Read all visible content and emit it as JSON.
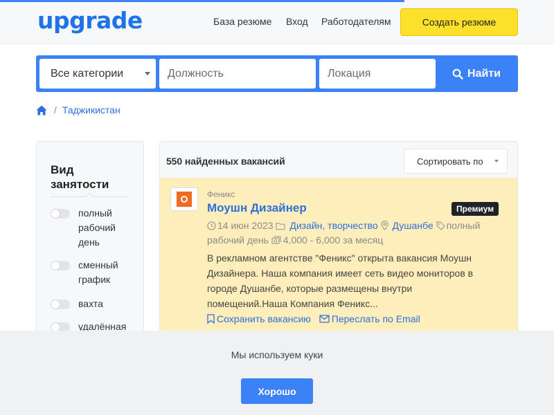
{
  "header": {
    "logo": "upgrade",
    "nav": [
      "База резюме",
      "Вход",
      "Работодателям"
    ],
    "create_resume_label": "Создать резюме"
  },
  "search": {
    "category_value": "Все категории",
    "position_placeholder": "Должность",
    "location_placeholder": "Локация",
    "find_label": "Найти"
  },
  "breadcrumb": {
    "home_icon": "home-icon",
    "items": [
      "Таджикистан"
    ]
  },
  "filters": {
    "title": "Вид занятости",
    "options": [
      {
        "label": "полный рабочий день",
        "checked": false
      },
      {
        "label": "сменный график",
        "checked": false
      },
      {
        "label": "вахта",
        "checked": false
      },
      {
        "label": "удалённая",
        "checked": false
      }
    ]
  },
  "results": {
    "count_text": "550 найденных вакансий",
    "sort_label": "Сортировать по"
  },
  "job": {
    "company": "Феникс",
    "title": "Моушн Дизайнер",
    "badge": "Премиум",
    "date": "14 июн 2023",
    "category": "Дизайн, творчество",
    "city": "Душанбе",
    "employment": "полный рабочий день",
    "salary": "4,000  -  6,000 за месяц",
    "description": "В рекламном агентстве \"Феникс\" открыта вакансия Моушн Дизайнера. Наша компания имеет сеть видео мониторов в городе Душанбе, которые размещены внутри помещений.Наша Компания Феникс...",
    "save_label": "Сохранить вакансию",
    "email_label": "Переслать по Email"
  },
  "cookie": {
    "text": "Мы используем куки",
    "ok_label": "Хорошо"
  },
  "colors": {
    "accent": "#3b82f6",
    "link": "#2f6fdc",
    "cta_yellow": "#fde02a",
    "premium_card": "#fdeebb",
    "company_logo": "#f26b22"
  }
}
